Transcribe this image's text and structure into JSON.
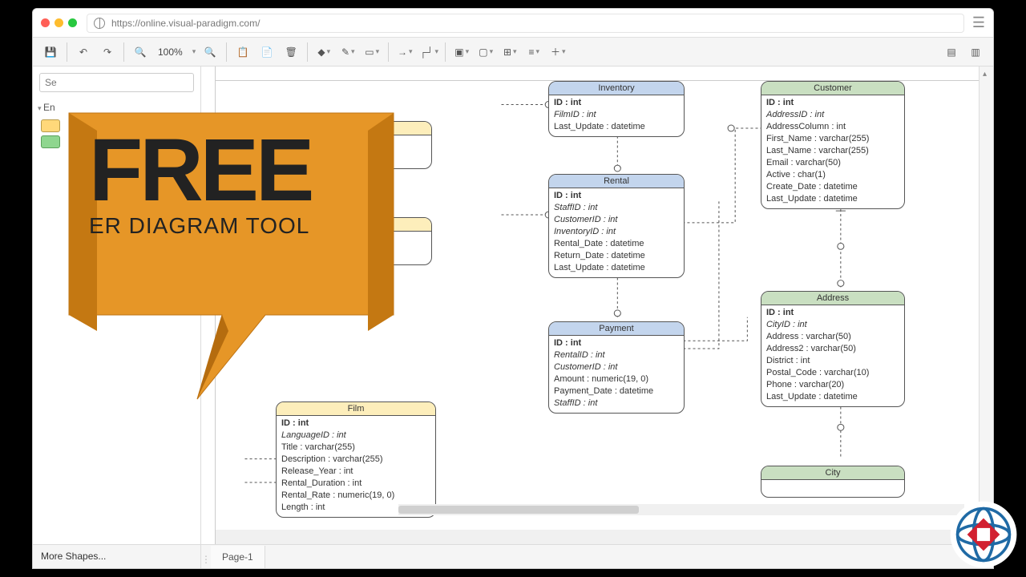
{
  "browser": {
    "url": "https://online.visual-paradigm.com/"
  },
  "toolbar": {
    "zoom": "100%"
  },
  "sidebar": {
    "search_placeholder": "Se",
    "category": "En",
    "more_shapes": "More Shapes..."
  },
  "footer": {
    "page_tab": "Page-1"
  },
  "banner": {
    "big": "FREE",
    "sub": "ER DIAGRAM TOOL"
  },
  "entities": {
    "inventory": {
      "name": "Inventory",
      "fields": [
        "ID : int",
        "FilmID : int",
        "Last_Update : datetime"
      ],
      "bold": [
        0
      ],
      "italic": [
        1
      ]
    },
    "rental": {
      "name": "Rental",
      "fields": [
        "ID : int",
        "StaffID : int",
        "CustomerID : int",
        "InventoryID : int",
        "Rental_Date : datetime",
        "Return_Date : datetime",
        "Last_Update : datetime"
      ],
      "bold": [
        0
      ],
      "italic": [
        1,
        2,
        3
      ]
    },
    "payment": {
      "name": "Payment",
      "fields": [
        "ID : int",
        "RentalID : int",
        "CustomerID : int",
        "Amount : numeric(19, 0)",
        "Payment_Date : datetime",
        "StaffID : int"
      ],
      "bold": [
        0
      ],
      "italic": [
        1,
        2,
        5
      ]
    },
    "customer": {
      "name": "Customer",
      "fields": [
        "ID : int",
        "AddressID : int",
        "AddressColumn : int",
        "First_Name : varchar(255)",
        "Last_Name : varchar(255)",
        "Email : varchar(50)",
        "Active : char(1)",
        "Create_Date : datetime",
        "Last_Update : datetime"
      ],
      "bold": [
        0
      ],
      "italic": [
        1
      ]
    },
    "address": {
      "name": "Address",
      "fields": [
        "ID : int",
        "CityID : int",
        "Address : varchar(50)",
        "Address2 : varchar(50)",
        "District : int",
        "Postal_Code : varchar(10)",
        "Phone : varchar(20)",
        "Last_Update : datetime"
      ],
      "bold": [
        0
      ],
      "italic": [
        1
      ]
    },
    "city": {
      "name": "City"
    },
    "film": {
      "name": "Film",
      "fields": [
        "ID : int",
        "LanguageID : int",
        "Title : varchar(255)",
        "Description : varchar(255)",
        "Release_Year : int",
        "Rental_Duration : int",
        "Rental_Rate : numeric(19, 0)",
        "Length : int"
      ],
      "bold": [
        0
      ],
      "italic": [
        1
      ]
    }
  }
}
